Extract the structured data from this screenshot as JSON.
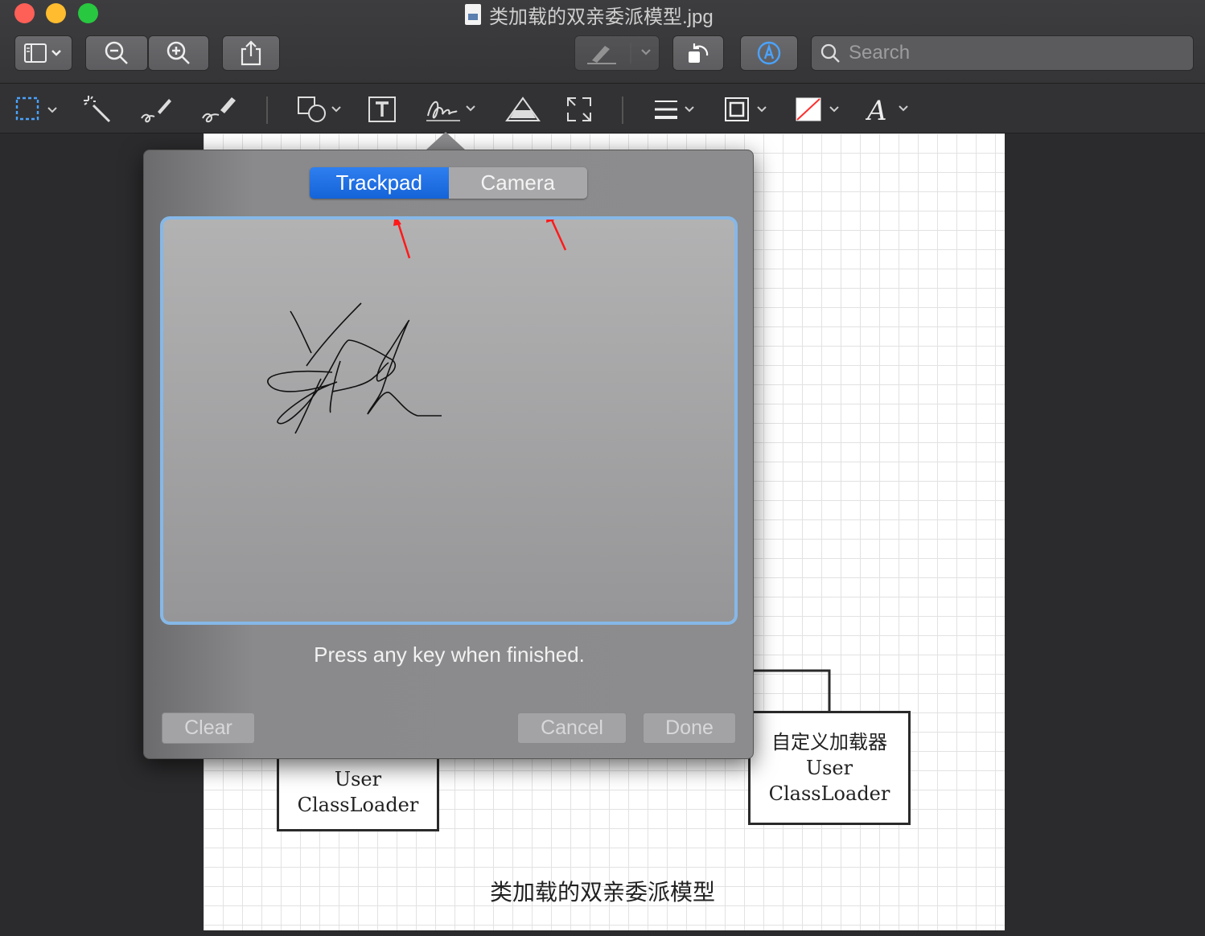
{
  "window": {
    "title": "类加载的双亲委派模型.jpg"
  },
  "toolbar": {
    "sidebar_button": "sidebar-toggle",
    "zoom_out": "zoom-out",
    "zoom_in": "zoom-in",
    "share": "share",
    "highlight": "highlight",
    "rotate": "rotate",
    "markup": "markup",
    "search_placeholder": "Search"
  },
  "markup_tools": [
    "rect-selection",
    "instant-alpha",
    "sketch",
    "draw",
    "shapes",
    "text",
    "sign",
    "adjust-color",
    "adjust-size",
    "shape-style",
    "border-color",
    "fill-color",
    "text-style"
  ],
  "signature_popover": {
    "tabs": [
      {
        "label": "Trackpad",
        "selected": true
      },
      {
        "label": "Camera",
        "selected": false
      }
    ],
    "hint": "Press any key when finished.",
    "buttons": {
      "clear": "Clear",
      "cancel": "Cancel",
      "done": "Done"
    }
  },
  "document": {
    "left_box": {
      "line1": "User",
      "line2": "ClassLoader"
    },
    "right_box": {
      "line1": "自定义加载器",
      "line2": "User",
      "line3": "ClassLoader"
    },
    "caption": "类加载的双亲委派模型"
  },
  "colors": {
    "accent": "#1a6ee6",
    "annotation_arrow": "#ff1a1a",
    "pad_border": "#86b8e8"
  }
}
